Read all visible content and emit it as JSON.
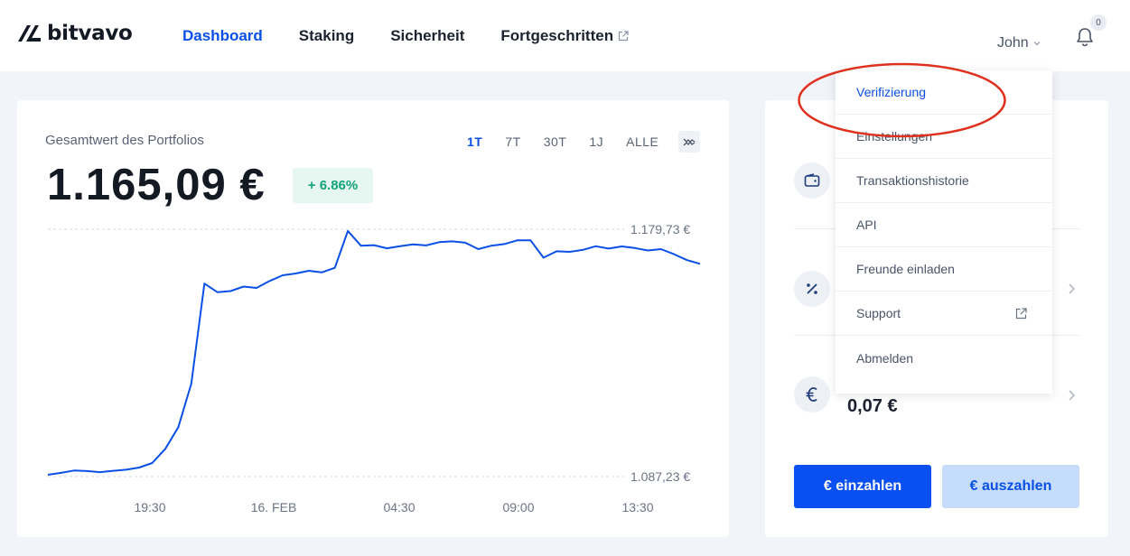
{
  "brand": {
    "name": "bitvavo"
  },
  "nav": {
    "items": [
      {
        "label": "Dashboard",
        "active": true
      },
      {
        "label": "Staking",
        "active": false
      },
      {
        "label": "Sicherheit",
        "active": false
      },
      {
        "label": "Fortgeschritten",
        "active": false,
        "external": true
      }
    ]
  },
  "user": {
    "name": "John",
    "notifications": "0"
  },
  "portfolio": {
    "title": "Gesamtwert des Portfolios",
    "value": "1.165,09 €",
    "change": "+ 6.86%",
    "ranges": [
      {
        "label": "1T",
        "active": true
      },
      {
        "label": "7T",
        "active": false
      },
      {
        "label": "30T",
        "active": false
      },
      {
        "label": "1J",
        "active": false
      },
      {
        "label": "ALLE",
        "active": false
      }
    ]
  },
  "chart_data": {
    "type": "line",
    "title": "",
    "xlabel": "",
    "ylabel": "",
    "x_tick_labels": [
      "19:30",
      "16. FEB",
      "04:30",
      "09:00",
      "13:30"
    ],
    "y_tick_labels": [
      "1.179,73 €",
      "1.087,23 €"
    ],
    "ylim": [
      1087.23,
      1179.73
    ],
    "x": [
      0,
      2,
      4,
      6,
      8,
      10,
      12,
      14,
      16,
      18,
      20,
      22,
      24,
      26,
      28,
      30,
      32,
      34,
      36,
      38,
      40,
      42,
      44,
      46,
      48,
      50,
      52,
      54,
      56,
      58,
      60,
      62,
      64,
      66,
      68,
      70,
      72,
      74,
      76,
      78,
      80,
      82,
      84,
      86,
      88,
      90,
      92,
      94,
      96,
      98,
      100
    ],
    "values": [
      1087.9,
      1088.6,
      1089.5,
      1089.3,
      1088.9,
      1089.4,
      1089.8,
      1090.6,
      1092.3,
      1097.6,
      1105.7,
      1122.0,
      1159.4,
      1156.2,
      1156.6,
      1158.3,
      1157.8,
      1160.4,
      1162.5,
      1163.2,
      1164.2,
      1163.6,
      1165.3,
      1179.1,
      1173.6,
      1173.8,
      1172.6,
      1173.4,
      1174.1,
      1173.7,
      1174.9,
      1175.2,
      1174.7,
      1172.3,
      1173.6,
      1174.2,
      1175.6,
      1175.6,
      1169.1,
      1171.5,
      1171.3,
      1172.0,
      1173.4,
      1172.5,
      1173.3,
      1172.7,
      1171.8,
      1172.3,
      1170.4,
      1168.2,
      1166.8
    ]
  },
  "menu": {
    "items": [
      {
        "label": "Verifizierung",
        "active": true
      },
      {
        "label": "Einstellungen",
        "active": false
      },
      {
        "label": "Transaktionshistorie",
        "active": false
      },
      {
        "label": "API",
        "active": false
      },
      {
        "label": "Freunde einladen",
        "active": false
      },
      {
        "label": "Support",
        "active": false,
        "external": true
      },
      {
        "label": "Abmelden",
        "active": false
      }
    ]
  },
  "balances": {
    "euro_value": "0,07 €",
    "icons": [
      "wallet-icon",
      "percent-icon",
      "euro-icon"
    ]
  },
  "actions": {
    "deposit": "€ einzahlen",
    "withdraw": "€ auszahlen"
  },
  "colors": {
    "accent": "#0a50e6",
    "positive": "#13a37a",
    "highlight_ring": "#e0311e"
  }
}
